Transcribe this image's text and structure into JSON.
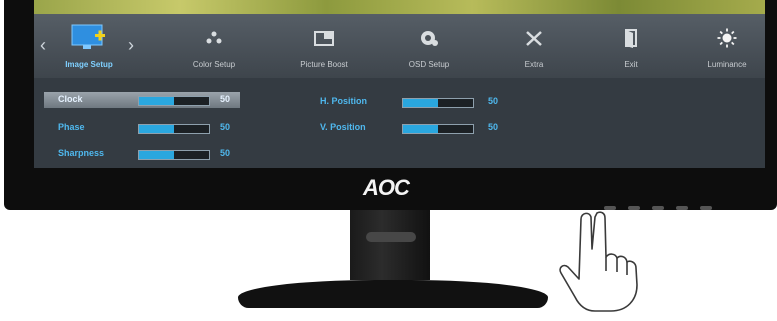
{
  "brand": "AOC",
  "osd": {
    "tabs": [
      {
        "label": "Image Setup",
        "icon": "monitor-image-setup-icon",
        "active": true
      },
      {
        "label": "Color Setup",
        "icon": "color-dots-icon"
      },
      {
        "label": "Picture Boost",
        "icon": "picture-boost-icon"
      },
      {
        "label": "OSD Setup",
        "icon": "osd-setup-icon"
      },
      {
        "label": "Extra",
        "icon": "tools-extra-icon"
      },
      {
        "label": "Exit",
        "icon": "exit-door-icon"
      },
      {
        "label": "Luminance",
        "icon": "sun-luminance-icon"
      }
    ],
    "left_settings": [
      {
        "label": "Clock",
        "value": "50",
        "level": 0.5,
        "selected": true
      },
      {
        "label": "Phase",
        "value": "50",
        "level": 0.5
      },
      {
        "label": "Sharpness",
        "value": "50",
        "level": 0.5
      }
    ],
    "right_settings": [
      {
        "label": "H. Position",
        "value": "50",
        "level": 0.5
      },
      {
        "label": "V. Position",
        "value": "50",
        "level": 0.5
      }
    ]
  },
  "colors": {
    "accent": "#2aa7df",
    "label": "#4fb8ee",
    "osd_background": "#343b42"
  }
}
